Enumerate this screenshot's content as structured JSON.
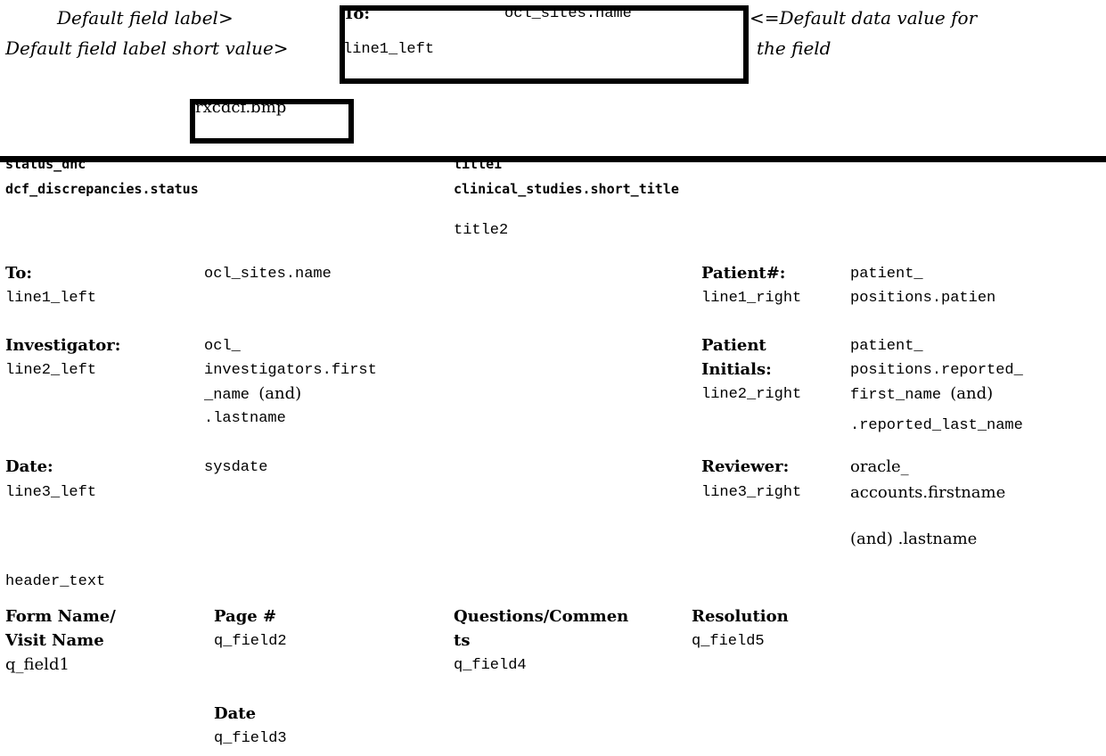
{
  "legend": {
    "default_field_label": "Default field label>",
    "default_field_label_short": "Default field label short value>",
    "default_data_value_line1": "<=Default data value for",
    "default_data_value_line2": "the field",
    "sample": {
      "label": "To:",
      "value": "ocl_sites.name",
      "short": "line1_left"
    }
  },
  "logo_box": {
    "label": "rxcdcf.bmp"
  },
  "top": {
    "status_short": "status_dnc",
    "status_value": "dcf_discrepancies.status",
    "title1_short": "title1",
    "title1_value": "clinical_studies.short_title",
    "title2": "title2"
  },
  "fields": {
    "to": {
      "label": "To:",
      "short": "line1_left",
      "value": "ocl_sites.name"
    },
    "patient": {
      "label": "Patient#:",
      "short": "line1_right",
      "value_line1": "patient_",
      "value_line2": "positions.patien"
    },
    "investigator": {
      "label": "Investigator:",
      "short": "line2_left",
      "value_line1": "ocl_",
      "value_line2": "investigators.first",
      "value_line3a": "_name ",
      "value_line3b": "(and)",
      "value_line4": ".lastname"
    },
    "patient_initials": {
      "label_line1": "Patient",
      "label_line2": "Initials:",
      "short": "line2_right",
      "value_line1": "patient_",
      "value_line2": "positions.reported_",
      "value_line3a": "first_name ",
      "value_line3b": "(and)",
      "value_line4": ".reported_last_name"
    },
    "date": {
      "label": "Date:",
      "short": "line3_left",
      "value": "sysdate"
    },
    "reviewer": {
      "label": "Reviewer:",
      "short": "line3_right",
      "value_line1": "oracle_",
      "value_line2": "accounts.firstname",
      "value_line3": "(and) .lastname"
    }
  },
  "header_text": "header_text",
  "columns": {
    "form_name_line1": "Form Name/",
    "form_name_line2": "Visit Name",
    "form_field": "q_field1",
    "page_label": "Page #",
    "page_field": "q_field2",
    "questions_line1": "Questions/Commen",
    "questions_line2": "ts",
    "questions_field": "q_field4",
    "resolution_label": "Resolution",
    "resolution_field": "q_field5",
    "date_label": "Date",
    "date_field": "q_field3"
  }
}
